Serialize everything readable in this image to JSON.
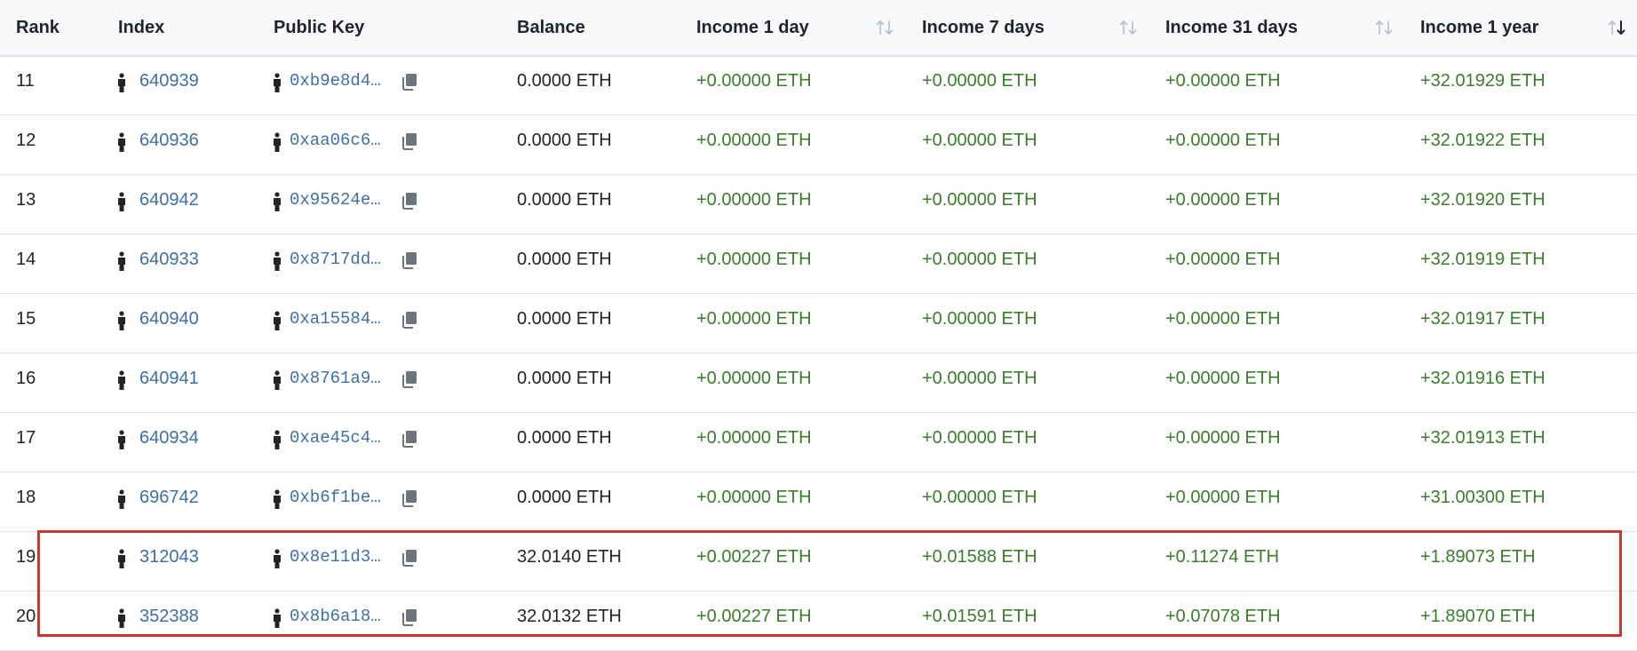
{
  "columns": {
    "rank": "Rank",
    "index": "Index",
    "public_key": "Public Key",
    "balance": "Balance",
    "income_1d": "Income 1 day",
    "income_7d": "Income 7 days",
    "income_31d": "Income 31 days",
    "income_1y": "Income 1 year"
  },
  "sort_state": {
    "income_1d": "unsorted",
    "income_7d": "unsorted",
    "income_31d": "unsorted",
    "income_1y": "descending"
  },
  "icons": {
    "validator": "person-icon",
    "copy": "copy-icon",
    "sort": "sort-arrows-icon"
  },
  "colors": {
    "link": "#3e6fa6",
    "positive": "#3a7d2c",
    "highlight": "#c6372c"
  },
  "rows": [
    {
      "rank": "11",
      "index": "640939",
      "key": "0xb9e8d4…",
      "balance": "0.0000 ETH",
      "d1": "+0.00000 ETH",
      "d7": "+0.00000 ETH",
      "d31": "+0.00000 ETH",
      "y1": "+32.01929 ETH"
    },
    {
      "rank": "12",
      "index": "640936",
      "key": "0xaa06c6…",
      "balance": "0.0000 ETH",
      "d1": "+0.00000 ETH",
      "d7": "+0.00000 ETH",
      "d31": "+0.00000 ETH",
      "y1": "+32.01922 ETH"
    },
    {
      "rank": "13",
      "index": "640942",
      "key": "0x95624e…",
      "balance": "0.0000 ETH",
      "d1": "+0.00000 ETH",
      "d7": "+0.00000 ETH",
      "d31": "+0.00000 ETH",
      "y1": "+32.01920 ETH"
    },
    {
      "rank": "14",
      "index": "640933",
      "key": "0x8717dd…",
      "balance": "0.0000 ETH",
      "d1": "+0.00000 ETH",
      "d7": "+0.00000 ETH",
      "d31": "+0.00000 ETH",
      "y1": "+32.01919 ETH"
    },
    {
      "rank": "15",
      "index": "640940",
      "key": "0xa15584…",
      "balance": "0.0000 ETH",
      "d1": "+0.00000 ETH",
      "d7": "+0.00000 ETH",
      "d31": "+0.00000 ETH",
      "y1": "+32.01917 ETH"
    },
    {
      "rank": "16",
      "index": "640941",
      "key": "0x8761a9…",
      "balance": "0.0000 ETH",
      "d1": "+0.00000 ETH",
      "d7": "+0.00000 ETH",
      "d31": "+0.00000 ETH",
      "y1": "+32.01916 ETH"
    },
    {
      "rank": "17",
      "index": "640934",
      "key": "0xae45c4…",
      "balance": "0.0000 ETH",
      "d1": "+0.00000 ETH",
      "d7": "+0.00000 ETH",
      "d31": "+0.00000 ETH",
      "y1": "+32.01913 ETH"
    },
    {
      "rank": "18",
      "index": "696742",
      "key": "0xb6f1be…",
      "balance": "0.0000 ETH",
      "d1": "+0.00000 ETH",
      "d7": "+0.00000 ETH",
      "d31": "+0.00000 ETH",
      "y1": "+31.00300 ETH"
    },
    {
      "rank": "19",
      "index": "312043",
      "key": "0x8e11d3…",
      "balance": "32.0140 ETH",
      "d1": "+0.00227 ETH",
      "d7": "+0.01588 ETH",
      "d31": "+0.11274 ETH",
      "y1": "+1.89073 ETH"
    },
    {
      "rank": "20",
      "index": "352388",
      "key": "0x8b6a18…",
      "balance": "32.0132 ETH",
      "d1": "+0.00227 ETH",
      "d7": "+0.01591 ETH",
      "d31": "+0.07078 ETH",
      "y1": "+1.89070 ETH"
    }
  ]
}
